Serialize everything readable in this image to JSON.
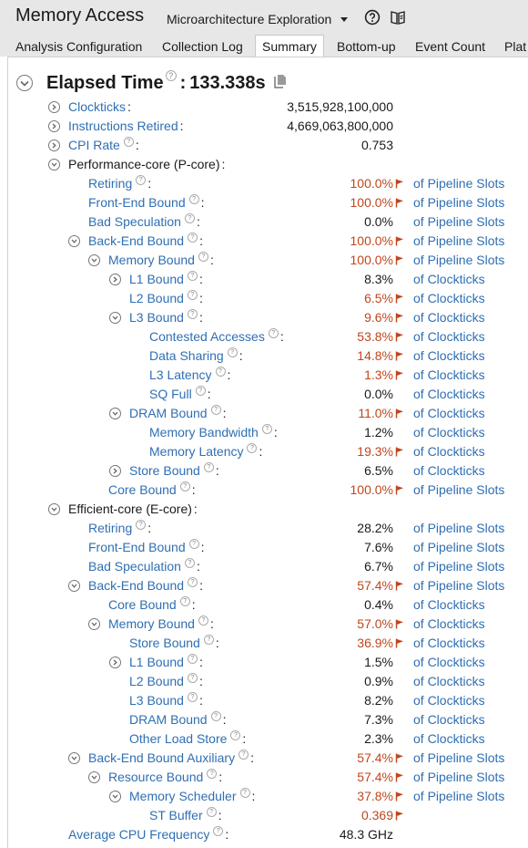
{
  "app": {
    "title": "Memory Access",
    "analysis_type": "Microarchitecture Exploration"
  },
  "tabs": [
    {
      "label": "Analysis Configuration"
    },
    {
      "label": "Collection Log"
    },
    {
      "label": "Summary",
      "active": true
    },
    {
      "label": "Bottom-up"
    },
    {
      "label": "Event Count"
    },
    {
      "label": "Plat"
    }
  ],
  "summary": {
    "elapsed_label": "Elapsed Time",
    "elapsed_sep": ":",
    "elapsed_value": "133.338s",
    "rows": [
      {
        "label": "Clockticks",
        "value": "3,515,928,100,000",
        "level": 0,
        "toggle": "collapsed",
        "link": true,
        "help": false
      },
      {
        "label": "Instructions Retired",
        "value": "4,669,063,800,000",
        "level": 0,
        "toggle": "collapsed",
        "link": true,
        "help": false
      },
      {
        "label": "CPI Rate",
        "value": "0.753",
        "level": 0,
        "toggle": "collapsed",
        "link": true,
        "help": true
      },
      {
        "label": "Performance-core (P-core)",
        "value": "",
        "level": 0,
        "toggle": "expanded",
        "link": false,
        "help": false
      },
      {
        "label": "Retiring",
        "value": "100.0%",
        "flag": true,
        "unit": "of Pipeline Slots",
        "level": 1,
        "link": true,
        "help": true
      },
      {
        "label": "Front-End Bound",
        "value": "100.0%",
        "flag": true,
        "unit": "of Pipeline Slots",
        "level": 1,
        "link": true,
        "help": true
      },
      {
        "label": "Bad Speculation",
        "value": "0.0%",
        "flag": false,
        "unit": "of Pipeline Slots",
        "level": 1,
        "link": true,
        "help": true
      },
      {
        "label": "Back-End Bound",
        "value": "100.0%",
        "flag": true,
        "unit": "of Pipeline Slots",
        "level": 1,
        "toggle": "expanded",
        "link": true,
        "help": true
      },
      {
        "label": "Memory Bound",
        "value": "100.0%",
        "flag": true,
        "unit": "of Pipeline Slots",
        "level": 2,
        "toggle": "expanded",
        "link": true,
        "help": true
      },
      {
        "label": "L1 Bound",
        "value": "8.3%",
        "flag": false,
        "unit": "of Clockticks",
        "level": 3,
        "toggle": "collapsed",
        "link": true,
        "help": true
      },
      {
        "label": "L2 Bound",
        "value": "6.5%",
        "flag": true,
        "unit": "of Clockticks",
        "level": 3,
        "link": true,
        "help": true
      },
      {
        "label": "L3 Bound",
        "value": "9.6%",
        "flag": true,
        "unit": "of Clockticks",
        "level": 3,
        "toggle": "expanded",
        "link": true,
        "help": true
      },
      {
        "label": "Contested Accesses",
        "value": "53.8%",
        "flag": true,
        "unit": "of Clockticks",
        "level": 4,
        "link": true,
        "help": true
      },
      {
        "label": "Data Sharing",
        "value": "14.8%",
        "flag": true,
        "unit": "of Clockticks",
        "level": 4,
        "link": true,
        "help": true
      },
      {
        "label": "L3 Latency",
        "value": "1.3%",
        "flag": true,
        "unit": "of Clockticks",
        "level": 4,
        "link": true,
        "help": true
      },
      {
        "label": "SQ Full",
        "value": "0.0%",
        "flag": false,
        "unit": "of Clockticks",
        "level": 4,
        "link": true,
        "help": true
      },
      {
        "label": "DRAM Bound",
        "value": "11.0%",
        "flag": true,
        "unit": "of Clockticks",
        "level": 3,
        "toggle": "expanded",
        "link": true,
        "help": true
      },
      {
        "label": "Memory Bandwidth",
        "value": "1.2%",
        "flag": false,
        "unit": "of Clockticks",
        "level": 4,
        "link": true,
        "help": true
      },
      {
        "label": "Memory Latency",
        "value": "19.3%",
        "flag": true,
        "unit": "of Clockticks",
        "level": 4,
        "link": true,
        "help": true
      },
      {
        "label": "Store Bound",
        "value": "6.5%",
        "flag": false,
        "unit": "of Clockticks",
        "level": 3,
        "toggle": "collapsed",
        "link": true,
        "help": true
      },
      {
        "label": "Core Bound",
        "value": "100.0%",
        "flag": true,
        "unit": "of Pipeline Slots",
        "level": 2,
        "link": true,
        "help": true
      },
      {
        "label": "Efficient-core (E-core)",
        "value": "",
        "level": 0,
        "toggle": "expanded",
        "link": false,
        "help": false
      },
      {
        "label": "Retiring",
        "value": "28.2%",
        "flag": false,
        "unit": "of Pipeline Slots",
        "level": 1,
        "link": true,
        "help": true
      },
      {
        "label": "Front-End Bound",
        "value": "7.6%",
        "flag": false,
        "unit": "of Pipeline Slots",
        "level": 1,
        "link": true,
        "help": true
      },
      {
        "label": "Bad Speculation",
        "value": "6.7%",
        "flag": false,
        "unit": "of Pipeline Slots",
        "level": 1,
        "link": true,
        "help": true
      },
      {
        "label": "Back-End Bound",
        "value": "57.4%",
        "flag": true,
        "unit": "of Pipeline Slots",
        "level": 1,
        "toggle": "expanded",
        "link": true,
        "help": true
      },
      {
        "label": "Core Bound",
        "value": "0.4%",
        "flag": false,
        "unit": "of Clockticks",
        "level": 2,
        "link": true,
        "help": true
      },
      {
        "label": "Memory Bound",
        "value": "57.0%",
        "flag": true,
        "unit": "of Clockticks",
        "level": 2,
        "toggle": "expanded",
        "link": true,
        "help": true
      },
      {
        "label": "Store Bound",
        "value": "36.9%",
        "flag": true,
        "unit": "of Clockticks",
        "level": 3,
        "link": true,
        "help": true
      },
      {
        "label": "L1 Bound",
        "value": "1.5%",
        "flag": false,
        "unit": "of Clockticks",
        "level": 3,
        "toggle": "collapsed",
        "link": true,
        "help": true
      },
      {
        "label": "L2 Bound",
        "value": "0.9%",
        "flag": false,
        "unit": "of Clockticks",
        "level": 3,
        "link": true,
        "help": true
      },
      {
        "label": "L3 Bound",
        "value": "8.2%",
        "flag": false,
        "unit": "of Clockticks",
        "level": 3,
        "link": true,
        "help": true
      },
      {
        "label": "DRAM Bound",
        "value": "7.3%",
        "flag": false,
        "unit": "of Clockticks",
        "level": 3,
        "link": true,
        "help": true
      },
      {
        "label": "Other Load Store",
        "value": "2.3%",
        "flag": false,
        "unit": "of Clockticks",
        "level": 3,
        "link": true,
        "help": true
      },
      {
        "label": "Back-End Bound Auxiliary",
        "value": "57.4%",
        "flag": true,
        "unit": "of Pipeline Slots",
        "level": 1,
        "toggle": "expanded",
        "link": true,
        "help": true
      },
      {
        "label": "Resource Bound",
        "value": "57.4%",
        "flag": true,
        "unit": "of Pipeline Slots",
        "level": 2,
        "toggle": "expanded",
        "link": true,
        "help": true
      },
      {
        "label": "Memory Scheduler",
        "value": "37.8%",
        "flag": true,
        "unit": "of Pipeline Slots",
        "level": 3,
        "toggle": "expanded",
        "link": true,
        "help": true
      },
      {
        "label": "ST Buffer",
        "value": "0.369",
        "flag": true,
        "unit": "",
        "level": 4,
        "link": true,
        "help": true
      },
      {
        "label": "Average CPU Frequency",
        "value": "48.3 GHz",
        "level": 0,
        "link": true,
        "help": true
      }
    ]
  },
  "colors": {
    "link": "#2f6fb3",
    "flagged_value": "#c0461c",
    "flag": "#c0461c",
    "toolbar_bg": "#e7e7e7"
  },
  "icons": {
    "help": "question-circle-icon",
    "book": "open-book-icon",
    "copy": "copy-icon",
    "flag": "flag-icon",
    "expand": "chevron-circle-icon"
  }
}
